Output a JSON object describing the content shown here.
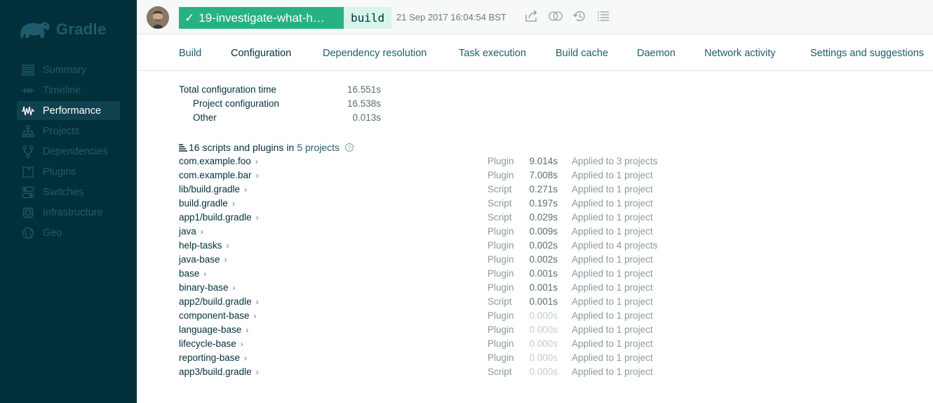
{
  "brand": {
    "name": "Gradle"
  },
  "sidebar": {
    "items": [
      {
        "label": "Summary",
        "icon": "summary-icon",
        "active": false
      },
      {
        "label": "Timeline",
        "icon": "timeline-icon",
        "active": false
      },
      {
        "label": "Performance",
        "icon": "performance-icon",
        "active": true
      },
      {
        "label": "Projects",
        "icon": "projects-icon",
        "active": false
      },
      {
        "label": "Dependencies",
        "icon": "dependencies-icon",
        "active": false
      },
      {
        "label": "Plugins",
        "icon": "plugins-icon",
        "active": false
      },
      {
        "label": "Switches",
        "icon": "switches-icon",
        "active": false
      },
      {
        "label": "Infrastructure",
        "icon": "infrastructure-icon",
        "active": false
      },
      {
        "label": "Geo",
        "icon": "geo-icon",
        "active": false
      }
    ]
  },
  "header": {
    "status_text": "19-investigate-what-h…",
    "task": "build",
    "timestamp": "21 Sep 2017 16:04:54 BST",
    "actions": [
      "share-icon",
      "compare-icon",
      "history-icon",
      "list-icon"
    ]
  },
  "tabs": [
    {
      "label": "Build",
      "active": false
    },
    {
      "label": "Configuration",
      "active": true
    },
    {
      "label": "Dependency resolution",
      "active": false
    },
    {
      "label": "Task execution",
      "active": false
    },
    {
      "label": "Build cache",
      "active": false
    },
    {
      "label": "Daemon",
      "active": false
    },
    {
      "label": "Network activity",
      "active": false
    },
    {
      "label": "Settings and suggestions",
      "active": false
    }
  ],
  "summary": {
    "total_label": "Total configuration time",
    "total_value": "16.551s",
    "project_label": "Project configuration",
    "project_value": "16.538s",
    "other_label": "Other",
    "other_value": "0.013s"
  },
  "plugins_heading": {
    "count_text": "16 scripts and plugins",
    "in_text": "in",
    "projects_link": "5 projects"
  },
  "rows": [
    {
      "name": "com.example.foo",
      "kind": "Plugin",
      "time": "9.014s",
      "applied": "Applied to 3 projects"
    },
    {
      "name": "com.example.bar",
      "kind": "Plugin",
      "time": "7.008s",
      "applied": "Applied to 1 project"
    },
    {
      "name": "lib/build.gradle",
      "kind": "Script",
      "time": "0.271s",
      "applied": "Applied to 1 project"
    },
    {
      "name": "build.gradle",
      "kind": "Script",
      "time": "0.197s",
      "applied": "Applied to 1 project"
    },
    {
      "name": "app1/build.gradle",
      "kind": "Script",
      "time": "0.029s",
      "applied": "Applied to 1 project"
    },
    {
      "name": "java",
      "kind": "Plugin",
      "time": "0.009s",
      "applied": "Applied to 1 project"
    },
    {
      "name": "help-tasks",
      "kind": "Plugin",
      "time": "0.002s",
      "applied": "Applied to 4 projects"
    },
    {
      "name": "java-base",
      "kind": "Plugin",
      "time": "0.002s",
      "applied": "Applied to 1 project"
    },
    {
      "name": "base",
      "kind": "Plugin",
      "time": "0.001s",
      "applied": "Applied to 1 project"
    },
    {
      "name": "binary-base",
      "kind": "Plugin",
      "time": "0.001s",
      "applied": "Applied to 1 project"
    },
    {
      "name": "app2/build.gradle",
      "kind": "Script",
      "time": "0.001s",
      "applied": "Applied to 1 project"
    },
    {
      "name": "component-base",
      "kind": "Plugin",
      "time": "0.000s",
      "applied": "Applied to 1 project"
    },
    {
      "name": "language-base",
      "kind": "Plugin",
      "time": "0.000s",
      "applied": "Applied to 1 project"
    },
    {
      "name": "lifecycle-base",
      "kind": "Plugin",
      "time": "0.000s",
      "applied": "Applied to 1 project"
    },
    {
      "name": "reporting-base",
      "kind": "Plugin",
      "time": "0.000s",
      "applied": "Applied to 1 project"
    },
    {
      "name": "app3/build.gradle",
      "kind": "Script",
      "time": "0.000s",
      "applied": "Applied to 1 project"
    }
  ],
  "colors": {
    "sidebar_bg": "#02303a",
    "success": "#26b283",
    "task_bg": "#d7f5ea",
    "link": "#1f5c6b"
  }
}
